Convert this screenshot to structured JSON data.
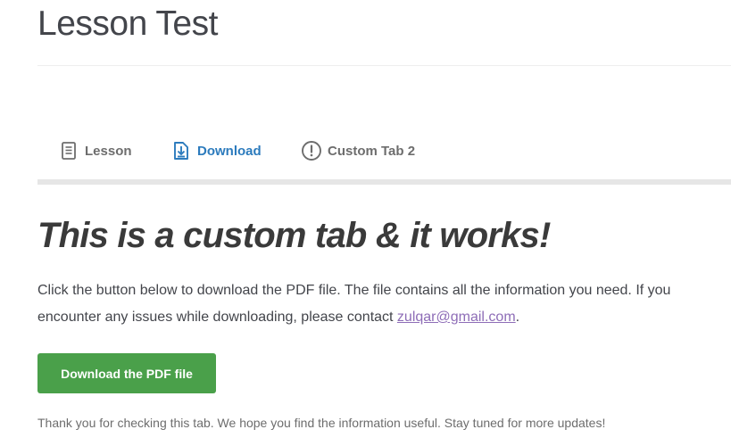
{
  "page": {
    "title": "Lesson Test"
  },
  "tabs": [
    {
      "label": "Lesson",
      "icon": "document-icon",
      "active": false
    },
    {
      "label": "Download",
      "icon": "download-icon",
      "active": true
    },
    {
      "label": "Custom Tab 2",
      "icon": "exclamation-circle-icon",
      "active": false
    }
  ],
  "content": {
    "heading": "This is a custom tab & it works!",
    "paragraph_before_link": "Click the button below to download the PDF file. The file contains all the information you need. If you encounter any issues while downloading, please contact ",
    "contact_email": "zulqar@gmail.com",
    "paragraph_after_link": ".",
    "download_button_label": "Download the PDF file",
    "thanks_text": "Thank you for checking this tab. We hope you find the information useful. Stay tuned for more updates!"
  },
  "colors": {
    "active_tab": "#2c7bbd",
    "inactive_tab": "#6d6d6d",
    "button_bg": "#4aa04a",
    "link": "#8e6db7"
  }
}
